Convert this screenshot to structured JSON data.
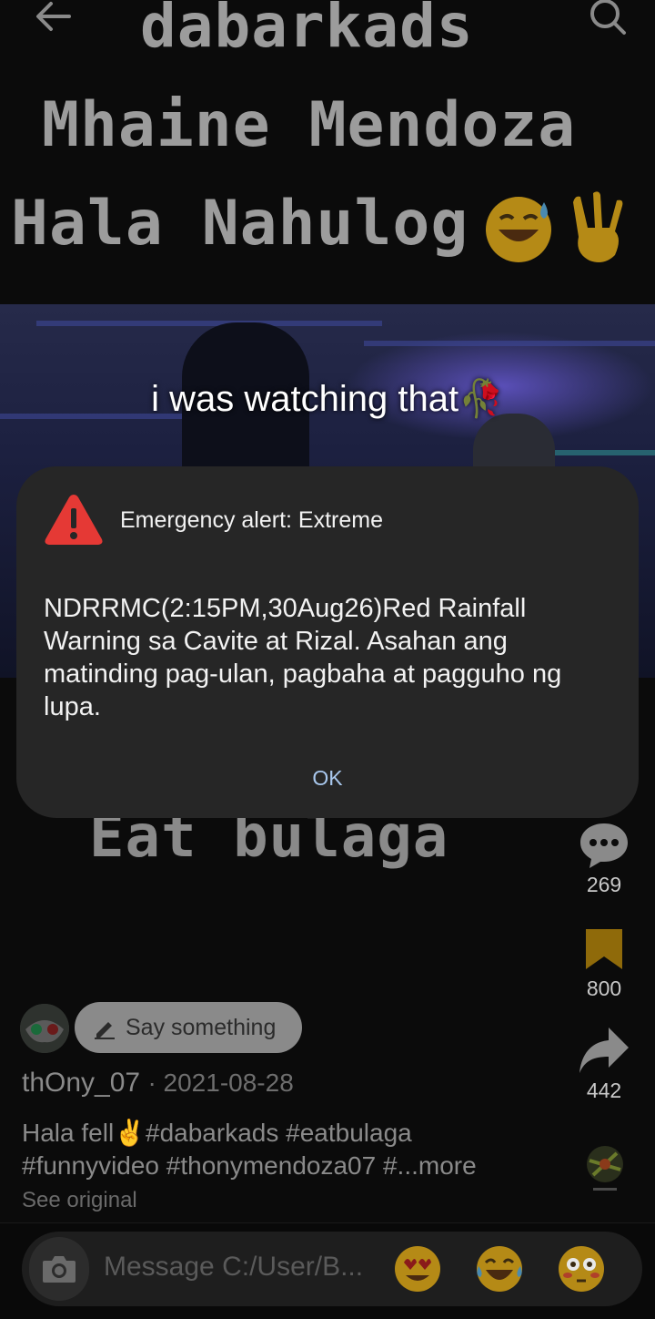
{
  "overlay_text": {
    "line1": "dabarkads",
    "line2": "Mhaine Mendoza",
    "line3": "Hala Nahulog",
    "bottom": "Eat bulaga"
  },
  "video": {
    "caption": "i was watching that"
  },
  "actions": {
    "comments_count": "269",
    "saves_count": "800",
    "shares_count": "442"
  },
  "post": {
    "say_something": "Say something",
    "author": "thOny_07",
    "date": "· 2021-08-28",
    "description": "Hala fell✌#dabarkads #eatbulaga #funnyvideo #thonymendoza07 #...more",
    "see_original": "See original"
  },
  "message_bar": {
    "placeholder": "Message C:/User/B..."
  },
  "alert": {
    "title": "Emergency alert: Extreme",
    "body": "NDRRMC(2:15PM,30Aug26)Red Rainfall Warning sa Cavite at Rizal. Asahan ang matinding pag-ulan, pagbaha at pagguho ng lupa.",
    "ok_label": "OK"
  },
  "colors": {
    "alert_bg": "#262626",
    "warning_red": "#e53935",
    "ok_blue": "#a9c8ee",
    "bookmark_yellow": "#f2b705"
  }
}
